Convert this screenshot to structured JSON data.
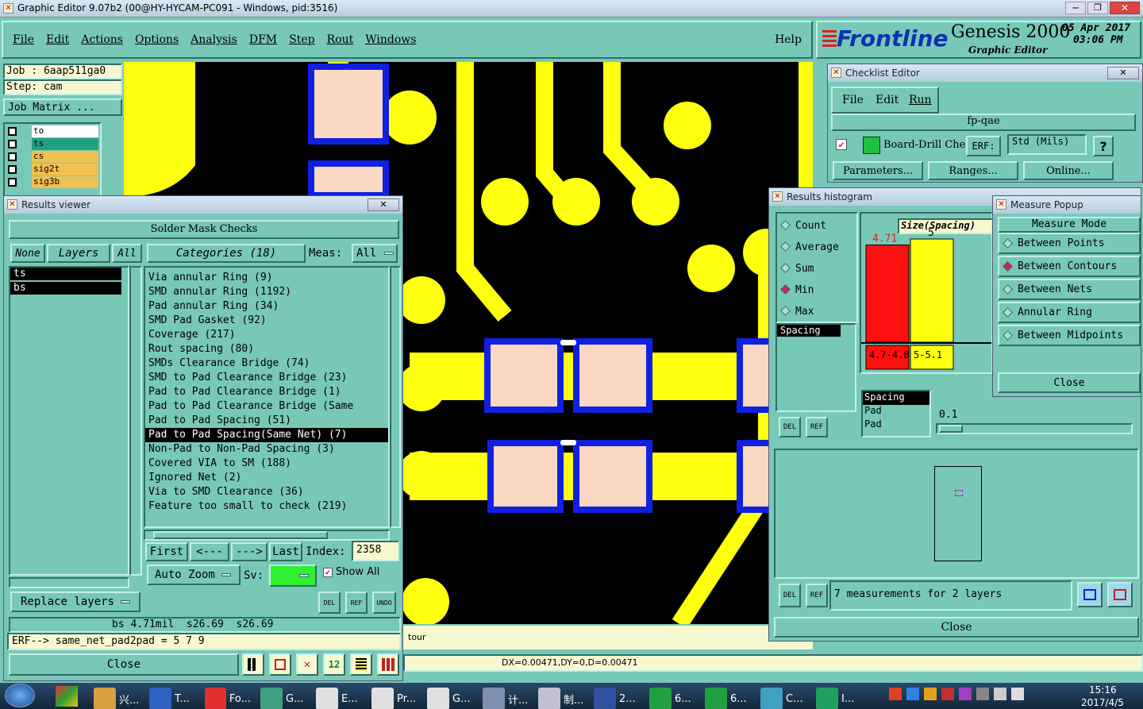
{
  "titlebar": {
    "title": "Graphic Editor 9.07b2 (00@HY-HYCAM-PC091 - Windows, pid:3516)"
  },
  "menubar": {
    "items": [
      "File",
      "Edit",
      "Actions",
      "Options",
      "Analysis",
      "DFM",
      "Step",
      "Rout",
      "Windows"
    ],
    "help": "Help"
  },
  "brand": {
    "logo": "Frontline",
    "product": "Genesis 2000",
    "subtitle": "Graphic Editor",
    "date": "05 Apr 2017",
    "time": "03:06 PM"
  },
  "job": {
    "job_label": "Job : 6aap511ga0",
    "step_label": "Step: cam",
    "matrix_button": "Job Matrix ..."
  },
  "layers": {
    "items": [
      "to",
      "ts",
      "cs",
      "sig2t",
      "sig3b"
    ]
  },
  "results_viewer": {
    "title": "Results viewer",
    "header": "Solder Mask Checks",
    "layer_tabs": {
      "none": "None",
      "layers": "Layers",
      "all": "All"
    },
    "layer_list": [
      "ts",
      "bs"
    ],
    "categories_label": "Categories (18)",
    "meas_label": "Meas:",
    "meas_value": "All",
    "categories": [
      "Via annular Ring (9)",
      "SMD annular Ring (1192)",
      "Pad annular Ring (34)",
      "SMD Pad Gasket (92)",
      "Coverage (217)",
      "Rout spacing (80)",
      "SMDs Clearance Bridge (74)",
      "SMD to Pad Clearance Bridge (23)",
      "Pad to Pad Clearance Bridge (1)",
      "Pad to Pad Clearance Bridge (Same",
      "Pad to Pad Spacing (51)",
      "Pad to Pad Spacing(Same Net) (7)",
      "Non-Pad to Non-Pad Spacing (3)",
      "Covered VIA to SM (188)",
      "Ignored Net (2)",
      "Via to SMD Clearance (36)",
      "Feature too small to check (219)"
    ],
    "selected_index": 11,
    "nav": {
      "first": "First",
      "prev": "<---",
      "next": "--->",
      "last": "Last",
      "index_label": "Index:",
      "index_value": "2358"
    },
    "auto_zoom": "Auto Zoom",
    "sv_label": "Sv:",
    "show_all": "Show All",
    "replace_layers": "Replace layers",
    "del": "DEL",
    "ref": "REF",
    "undo": "UNDO",
    "status": "bs 4.71mil  s26.69  s26.69",
    "erf_line": "ERF--> same_net_pad2pad = 5 7 9",
    "close": "Close"
  },
  "canvas_status": {
    "coords": "DX=0.00471,DY=0,D=0.00471",
    "partial": "tour"
  },
  "checklist": {
    "title": "Checklist Editor",
    "menu": [
      "File",
      "Edit",
      "Run"
    ],
    "name": "fp-qae",
    "check_name": "Board-Drill Che",
    "erf_label": "ERF:",
    "erf_value": "Std (Mils)",
    "help": "?",
    "buttons": [
      "Parameters...",
      "Ranges...",
      "Online..."
    ]
  },
  "histogram": {
    "title": "Results histogram",
    "modes": [
      "Count",
      "Average",
      "Sum",
      "Min",
      "Max"
    ],
    "selected_mode": "Min",
    "measure_title": "Size(Spacing)",
    "bars": [
      {
        "value_label": "4.71",
        "range_label": "4.7-4.8",
        "color": "#ff1010",
        "fraction": 0.942
      },
      {
        "value_label": "5",
        "range_label": "5-5.1",
        "color": "#ffff10",
        "fraction": 1.0
      }
    ],
    "list1": [
      "Spacing"
    ],
    "list2": [
      "Spacing",
      "Pad",
      "Pad"
    ],
    "slider_value": "0.1",
    "measurements": "7 measurements for 2 layers",
    "del": "DEL",
    "ref": "REF",
    "close": "Close"
  },
  "measure_popup": {
    "title": "Measure Popup",
    "header": "Measure Mode",
    "modes": [
      "Between Points",
      "Between Contours",
      "Between Nets",
      "Annular Ring",
      "Between Midpoints"
    ],
    "selected_mode": "Between Contours",
    "close": "Close"
  },
  "taskbar": {
    "items": [
      "兴...",
      "T...",
      "Fo...",
      "G...",
      "E...",
      "Pr...",
      "G...",
      "计...",
      "制...",
      "2...",
      "6...",
      "6...",
      "C...",
      "I..."
    ],
    "time": "15:16",
    "date": "2017/4/5"
  },
  "colors": {
    "accent": "#78c8b8",
    "trace": "#ffff10",
    "pad": "#f8d8c0",
    "mask": "#1020e0",
    "board": "#000000"
  }
}
